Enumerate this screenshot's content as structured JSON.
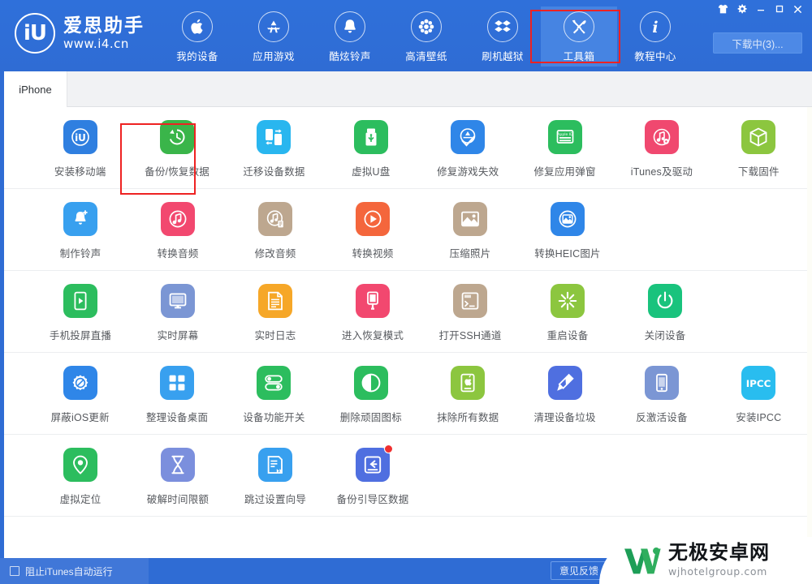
{
  "window": {
    "brand_mark": "iU",
    "brand_name": "爱思助手",
    "brand_url": "www.i4.cn",
    "download_button": "下载中(3)...",
    "controls": [
      {
        "name": "theme-shirt-icon",
        "label": ""
      },
      {
        "name": "settings-gear-icon",
        "label": ""
      },
      {
        "name": "minimize-icon",
        "label": ""
      },
      {
        "name": "maximize-icon",
        "label": ""
      },
      {
        "name": "close-icon",
        "label": ""
      }
    ],
    "accent_color": "#2f6cd4",
    "accent_active_color": "#4684e2",
    "annotation_color": "#ee2222"
  },
  "nav": {
    "items": [
      {
        "label": "我的设备",
        "icon": "apple-icon",
        "active": false
      },
      {
        "label": "应用游戏",
        "icon": "appstore-icon",
        "active": false
      },
      {
        "label": "酷炫铃声",
        "icon": "bell-icon",
        "active": false
      },
      {
        "label": "高清壁纸",
        "icon": "flower-icon",
        "active": false
      },
      {
        "label": "刷机越狱",
        "icon": "dropbox-icon",
        "active": false
      },
      {
        "label": "工具箱",
        "icon": "tools-icon",
        "active": true
      },
      {
        "label": "教程中心",
        "icon": "info-icon",
        "active": false
      }
    ]
  },
  "tabs": [
    {
      "label": "iPhone",
      "active": true
    }
  ],
  "toolbox": {
    "rows": [
      {
        "tiles": [
          {
            "label": "安装移动端",
            "icon": "i4-app-icon",
            "color": "#2f7fe0",
            "highlighted": false,
            "badge": false
          },
          {
            "label": "备份/恢复数据",
            "icon": "backup-restore-icon",
            "color": "#3ab54a",
            "highlighted": true,
            "badge": false
          },
          {
            "label": "迁移设备数据",
            "icon": "device-migrate-icon",
            "color": "#29b6ef",
            "highlighted": false,
            "badge": false
          },
          {
            "label": "虚拟U盘",
            "icon": "usb-drive-icon",
            "color": "#2cbd5e",
            "highlighted": false,
            "badge": false
          },
          {
            "label": "修复游戏失效",
            "icon": "appstore-fix-icon",
            "color": "#2f86e8",
            "highlighted": false,
            "badge": false
          },
          {
            "label": "修复应用弹窗",
            "icon": "apple-id-icon",
            "color": "#2cbd5e",
            "highlighted": false,
            "badge": false
          },
          {
            "label": "iTunes及驱动",
            "icon": "itunes-icon",
            "color": "#f0486f",
            "highlighted": false,
            "badge": false
          },
          {
            "label": "下载固件",
            "icon": "firmware-box-icon",
            "color": "#8cc63f",
            "highlighted": false,
            "badge": false
          }
        ]
      },
      {
        "tiles": [
          {
            "label": "制作铃声",
            "icon": "ringtone-add-icon",
            "color": "#38a0ef",
            "highlighted": false,
            "badge": false
          },
          {
            "label": "转换音频",
            "icon": "audio-convert-icon",
            "color": "#f2486f",
            "highlighted": false,
            "badge": false
          },
          {
            "label": "修改音频",
            "icon": "audio-edit-icon",
            "color": "#bda78f",
            "highlighted": false,
            "badge": false
          },
          {
            "label": "转换视频",
            "icon": "video-convert-icon",
            "color": "#f4663c",
            "highlighted": false,
            "badge": false
          },
          {
            "label": "压缩照片",
            "icon": "photo-compress-icon",
            "color": "#bda78f",
            "highlighted": false,
            "badge": false
          },
          {
            "label": "转换HEIC图片",
            "icon": "heic-convert-icon",
            "color": "#2f86e8",
            "highlighted": false,
            "badge": false
          }
        ]
      },
      {
        "tiles": [
          {
            "label": "手机投屏直播",
            "icon": "screen-cast-icon",
            "color": "#2cbd5e",
            "highlighted": false,
            "badge": false
          },
          {
            "label": "实时屏幕",
            "icon": "realtime-screen-icon",
            "color": "#7b96d4",
            "highlighted": false,
            "badge": false
          },
          {
            "label": "实时日志",
            "icon": "realtime-log-icon",
            "color": "#f6a728",
            "highlighted": false,
            "badge": false
          },
          {
            "label": "进入恢复模式",
            "icon": "recovery-mode-icon",
            "color": "#f2486f",
            "highlighted": false,
            "badge": false
          },
          {
            "label": "打开SSH通道",
            "icon": "ssh-terminal-icon",
            "color": "#bda78f",
            "highlighted": false,
            "badge": false
          },
          {
            "label": "重启设备",
            "icon": "reboot-icon",
            "color": "#8cc63f",
            "highlighted": false,
            "badge": false
          },
          {
            "label": "关闭设备",
            "icon": "power-off-icon",
            "color": "#19c37d",
            "highlighted": false,
            "badge": false
          }
        ]
      },
      {
        "tiles": [
          {
            "label": "屏蔽iOS更新",
            "icon": "block-update-icon",
            "color": "#2f86e8",
            "highlighted": false,
            "badge": false
          },
          {
            "label": "整理设备桌面",
            "icon": "organize-home-icon",
            "color": "#38a0ef",
            "highlighted": false,
            "badge": false
          },
          {
            "label": "设备功能开关",
            "icon": "feature-toggle-icon",
            "color": "#2cbd5e",
            "highlighted": false,
            "badge": false
          },
          {
            "label": "删除顽固图标",
            "icon": "delete-icon-icon",
            "color": "#2cbd5e",
            "highlighted": false,
            "badge": false
          },
          {
            "label": "抹除所有数据",
            "icon": "erase-all-icon",
            "color": "#8cc63f",
            "highlighted": false,
            "badge": false
          },
          {
            "label": "清理设备垃圾",
            "icon": "clean-junk-icon",
            "color": "#4f6fe0",
            "highlighted": false,
            "badge": false
          },
          {
            "label": "反激活设备",
            "icon": "deactivate-icon",
            "color": "#7b96d4",
            "highlighted": false,
            "badge": false
          },
          {
            "label": "安装IPCC",
            "icon": "ipcc-icon",
            "color": "#29bdef",
            "highlighted": false,
            "badge": false
          }
        ]
      },
      {
        "tiles": [
          {
            "label": "虚拟定位",
            "icon": "location-pin-icon",
            "color": "#2cbd5e",
            "highlighted": false,
            "badge": false
          },
          {
            "label": "破解时间限额",
            "icon": "hourglass-icon",
            "color": "#7b8fdd",
            "highlighted": false,
            "badge": false
          },
          {
            "label": "跳过设置向导",
            "icon": "skip-setup-icon",
            "color": "#38a0ef",
            "highlighted": false,
            "badge": false
          },
          {
            "label": "备份引导区数据",
            "icon": "backup-boot-icon",
            "color": "#4f6fe0",
            "highlighted": false,
            "badge": true
          }
        ]
      }
    ]
  },
  "statusbar": {
    "prevent_itunes_label": "阻止iTunes自动运行",
    "prevent_itunes_checked": false,
    "feedback_label": "意见反馈"
  },
  "watermark": {
    "title": "无极安卓网",
    "subtitle": "wjhotelgroup.com",
    "logo_color": "#1d9e57"
  }
}
